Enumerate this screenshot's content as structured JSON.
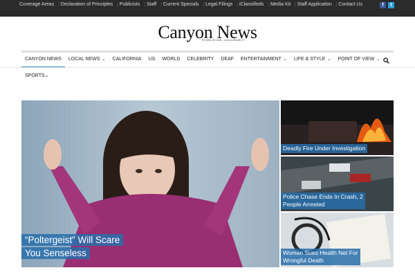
{
  "topbar": {
    "links": [
      "Coverage Areas",
      "Declaration of Principles",
      "Publicists",
      "Staff",
      "Current Specials",
      "Legal Filings",
      "iClassifieds",
      "Media Kit",
      "Staff Application",
      "Contact Us"
    ],
    "social_icons": [
      "facebook-icon",
      "twitter-icon"
    ]
  },
  "logo": {
    "title": "Canyon News",
    "tagline": "We print the truth... can you handle it?"
  },
  "nav": {
    "items": [
      {
        "label": "CANYON NEWS",
        "dropdown": false,
        "active": true
      },
      {
        "label": "LOCAL NEWS",
        "dropdown": true,
        "active": false
      },
      {
        "label": "CALIFORNIA",
        "dropdown": false,
        "active": false
      },
      {
        "label": "US",
        "dropdown": false,
        "active": false
      },
      {
        "label": "WORLD",
        "dropdown": false,
        "active": false
      },
      {
        "label": "CELEBRITY",
        "dropdown": false,
        "active": false
      },
      {
        "label": "DEAF",
        "dropdown": false,
        "active": false
      },
      {
        "label": "ENTERTAINMENT",
        "dropdown": true,
        "active": false
      },
      {
        "label": "LIFE & STYLE",
        "dropdown": true,
        "active": false
      },
      {
        "label": "POINT OF VIEW",
        "dropdown": true,
        "active": false
      }
    ],
    "second_row": [
      {
        "label": "SPORTS",
        "dropdown": true
      }
    ],
    "accent_color": "#3a8fc8"
  },
  "featured": {
    "main": {
      "title_line1": "“Poltergeist” Will Scare",
      "title_line2": "You Senseless"
    },
    "side": [
      {
        "title_line1": "Deadly Fire Under Investigation",
        "title_line2": ""
      },
      {
        "title_line1": "Police Chase Ends In Crash, 2",
        "title_line2": "People Arrested"
      },
      {
        "title_line1": "Woman Sues Health Net For",
        "title_line2": "Wrongful Death"
      }
    ],
    "caption_color": "#286eaa"
  }
}
